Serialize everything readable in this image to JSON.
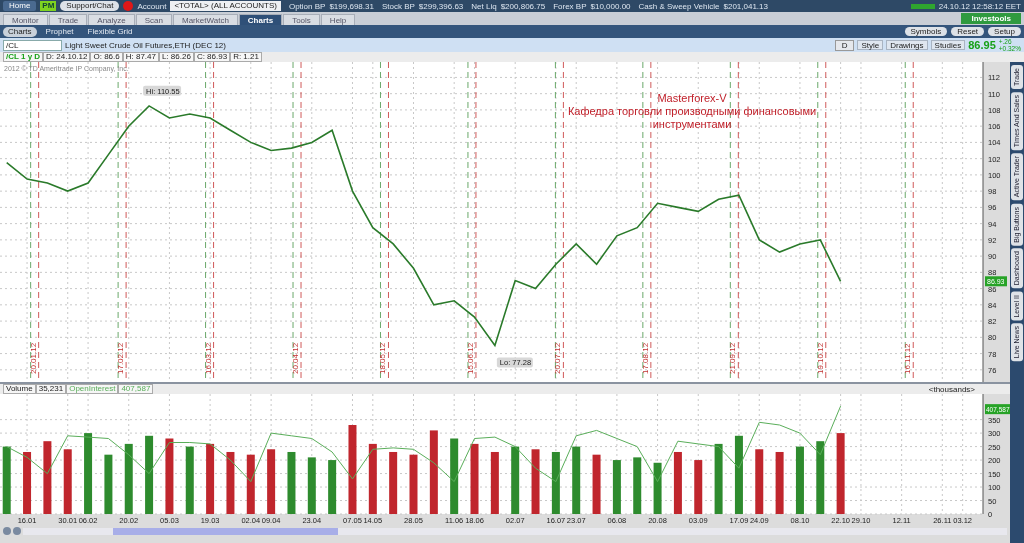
{
  "top_bar": {
    "home": "Home",
    "pm": "PM",
    "support": "Support/Chat",
    "account_label": "Account",
    "account": "<TOTAL> (ALL ACCOUNTS)",
    "balances": [
      {
        "label": "Option BP",
        "value": "$199,698.31"
      },
      {
        "label": "Stock BP",
        "value": "$299,396.63"
      },
      {
        "label": "Net Liq",
        "value": "$200,806.75"
      },
      {
        "label": "Forex BP",
        "value": "$10,000.00"
      },
      {
        "label": "Cash & Sweep Vehicle",
        "value": "$201,041.13"
      }
    ],
    "datetime": "24.10.12 12:58:12 EET"
  },
  "main_tabs": [
    {
      "label": "Monitor",
      "selected": false
    },
    {
      "label": "Trade",
      "selected": false
    },
    {
      "label": "Analyze",
      "selected": false
    },
    {
      "label": "Scan",
      "selected": false
    },
    {
      "label": "MarketWatch",
      "selected": false
    },
    {
      "label": "Charts",
      "selected": true
    },
    {
      "label": "Tools",
      "selected": false
    },
    {
      "label": "Help",
      "selected": false
    }
  ],
  "investools": "Investools",
  "sub_tabs": [
    {
      "label": "Charts",
      "selected": true
    },
    {
      "label": "Prophet",
      "selected": false
    },
    {
      "label": "Flexible Grid",
      "selected": false
    }
  ],
  "toolbar_buttons": [
    "Symbols",
    "Reset",
    "Setup"
  ],
  "chart_header": {
    "symbol": "/CL",
    "description": "Light Sweet Crude Oil Futures,ETH (DEC 12)",
    "aggregation": "D",
    "buttons": [
      "Style",
      "Drawings",
      "Studies"
    ],
    "last": "86.95",
    "change": "+.26",
    "change_pct": "+0.32%"
  },
  "info_bar": [
    "/CL 1 y D",
    "D: 24.10.12",
    "O: 86.6",
    "H: 87.47",
    "L: 86.26",
    "C: 86.93",
    "R: 1.21"
  ],
  "price_pane": {
    "copyright": "2012 © TD Ameritrade IP Company, Inc.",
    "high_label": "Hi: 110.55",
    "low_label": "Lo: 77.28",
    "last_tag": "86.93",
    "annotation": [
      "Masterforex-V",
      "Кафедра торговли производными финансовыми",
      "инструментами"
    ],
    "chart_data": {
      "type": "line",
      "categories": [
        null,
        null,
        null,
        null,
        null,
        null,
        null,
        null,
        null,
        null,
        null,
        null,
        null,
        null,
        null,
        null,
        null,
        null,
        null,
        null,
        null,
        null,
        null,
        null,
        null,
        null,
        null,
        null,
        null,
        null,
        null,
        null,
        null,
        null,
        null,
        null,
        null,
        null,
        null,
        null,
        null,
        null,
        null,
        null,
        null,
        null,
        null,
        null
      ],
      "series": [
        {
          "color": "#2a7a2a",
          "values": [
            101.5,
            99.5,
            99,
            98,
            99,
            102.5,
            106,
            108.5,
            107,
            107.5,
            107,
            105.5,
            104,
            103,
            103.3,
            104,
            105.5,
            98,
            93.5,
            91.5,
            88.5,
            84,
            84.5,
            82.5,
            79,
            87,
            86,
            89,
            91.5,
            89,
            92.5,
            93.5,
            96.5,
            96,
            95.5,
            97,
            97.5,
            92,
            90.5,
            91.5,
            92,
            86.9,
            null,
            null,
            null,
            null,
            null,
            null
          ]
        }
      ],
      "ylim": [
        74.5,
        113.9
      ],
      "yticks": [
        76,
        78,
        80,
        82,
        84,
        86,
        88,
        90,
        92,
        94,
        96,
        98,
        100,
        102,
        104,
        106,
        108,
        110,
        112
      ],
      "grid": true,
      "annotations": [
        "20.01.12",
        "17.02.12",
        "16.03.12",
        "20.04.12",
        "18.05.12",
        "15.06.12",
        "20.07.12",
        "17.08.12",
        "21.09.12",
        "19.10.12",
        "16.11.12"
      ]
    }
  },
  "volume_pane": {
    "legend_values": [
      "35,231",
      "407,587"
    ],
    "units": "<thousands>",
    "last_tag": "407,587",
    "chart_data": {
      "type": "bar",
      "categories": [
        null,
        "16.01",
        null,
        "30.01",
        "06.02",
        null,
        "20.02",
        null,
        "05.03",
        null,
        "19.03",
        null,
        "02.04",
        "09.04",
        null,
        "23.04",
        null,
        "07.05",
        "14.05",
        null,
        "28.05",
        null,
        "11.06",
        "18.06",
        null,
        "02.07",
        null,
        "16.07",
        "23.07",
        null,
        "06.08",
        null,
        "20.08",
        null,
        "03.09",
        null,
        "17.09",
        "24.09",
        null,
        "08.10",
        null,
        "22.10",
        "29.10",
        null,
        "12.11",
        null,
        "26.11",
        "03.12"
      ],
      "series": [
        {
          "name": "Volume",
          "type": "bar",
          "color": "#c0262d",
          "values": [
            null,
            230,
            270,
            240,
            null,
            null,
            null,
            null,
            280,
            null,
            260,
            230,
            220,
            240,
            null,
            null,
            null,
            330,
            260,
            230,
            220,
            310,
            null,
            260,
            230,
            null,
            240,
            null,
            null,
            220,
            null,
            null,
            null,
            230,
            200,
            null,
            null,
            240,
            230,
            null,
            null,
            300,
            null,
            null,
            null,
            null,
            null,
            null
          ]
        },
        {
          "type": "bar",
          "color": "#2e8b2e",
          "values": [
            250,
            null,
            null,
            null,
            300,
            220,
            260,
            290,
            null,
            250,
            null,
            null,
            null,
            null,
            230,
            210,
            200,
            null,
            null,
            null,
            null,
            null,
            280,
            null,
            null,
            250,
            null,
            230,
            250,
            null,
            200,
            210,
            190,
            null,
            null,
            260,
            290,
            null,
            null,
            250,
            270,
            null,
            null,
            null,
            null,
            null,
            null,
            null
          ]
        },
        {
          "name": "OpenInterest",
          "type": "line",
          "color": "#5aae5a",
          "values": [
            250,
            210,
            150,
            290,
            285,
            280,
            220,
            150,
            265,
            265,
            260,
            200,
            120,
            300,
            290,
            280,
            230,
            130,
            240,
            245,
            240,
            190,
            120,
            280,
            285,
            250,
            170,
            120,
            290,
            310,
            280,
            250,
            120,
            270,
            260,
            250,
            170,
            340,
            330,
            300,
            220,
            400,
            null,
            null,
            null,
            null,
            null,
            null
          ]
        }
      ],
      "ylim": [
        0,
        445
      ],
      "yticks": [
        0,
        50,
        100,
        150,
        200,
        250,
        300,
        350
      ],
      "grid": true
    }
  },
  "side_tabs": [
    "Trade",
    "Times And Sales",
    "Active Trader",
    "Big Buttons",
    "Dashboard",
    "Level II",
    "Live News"
  ]
}
